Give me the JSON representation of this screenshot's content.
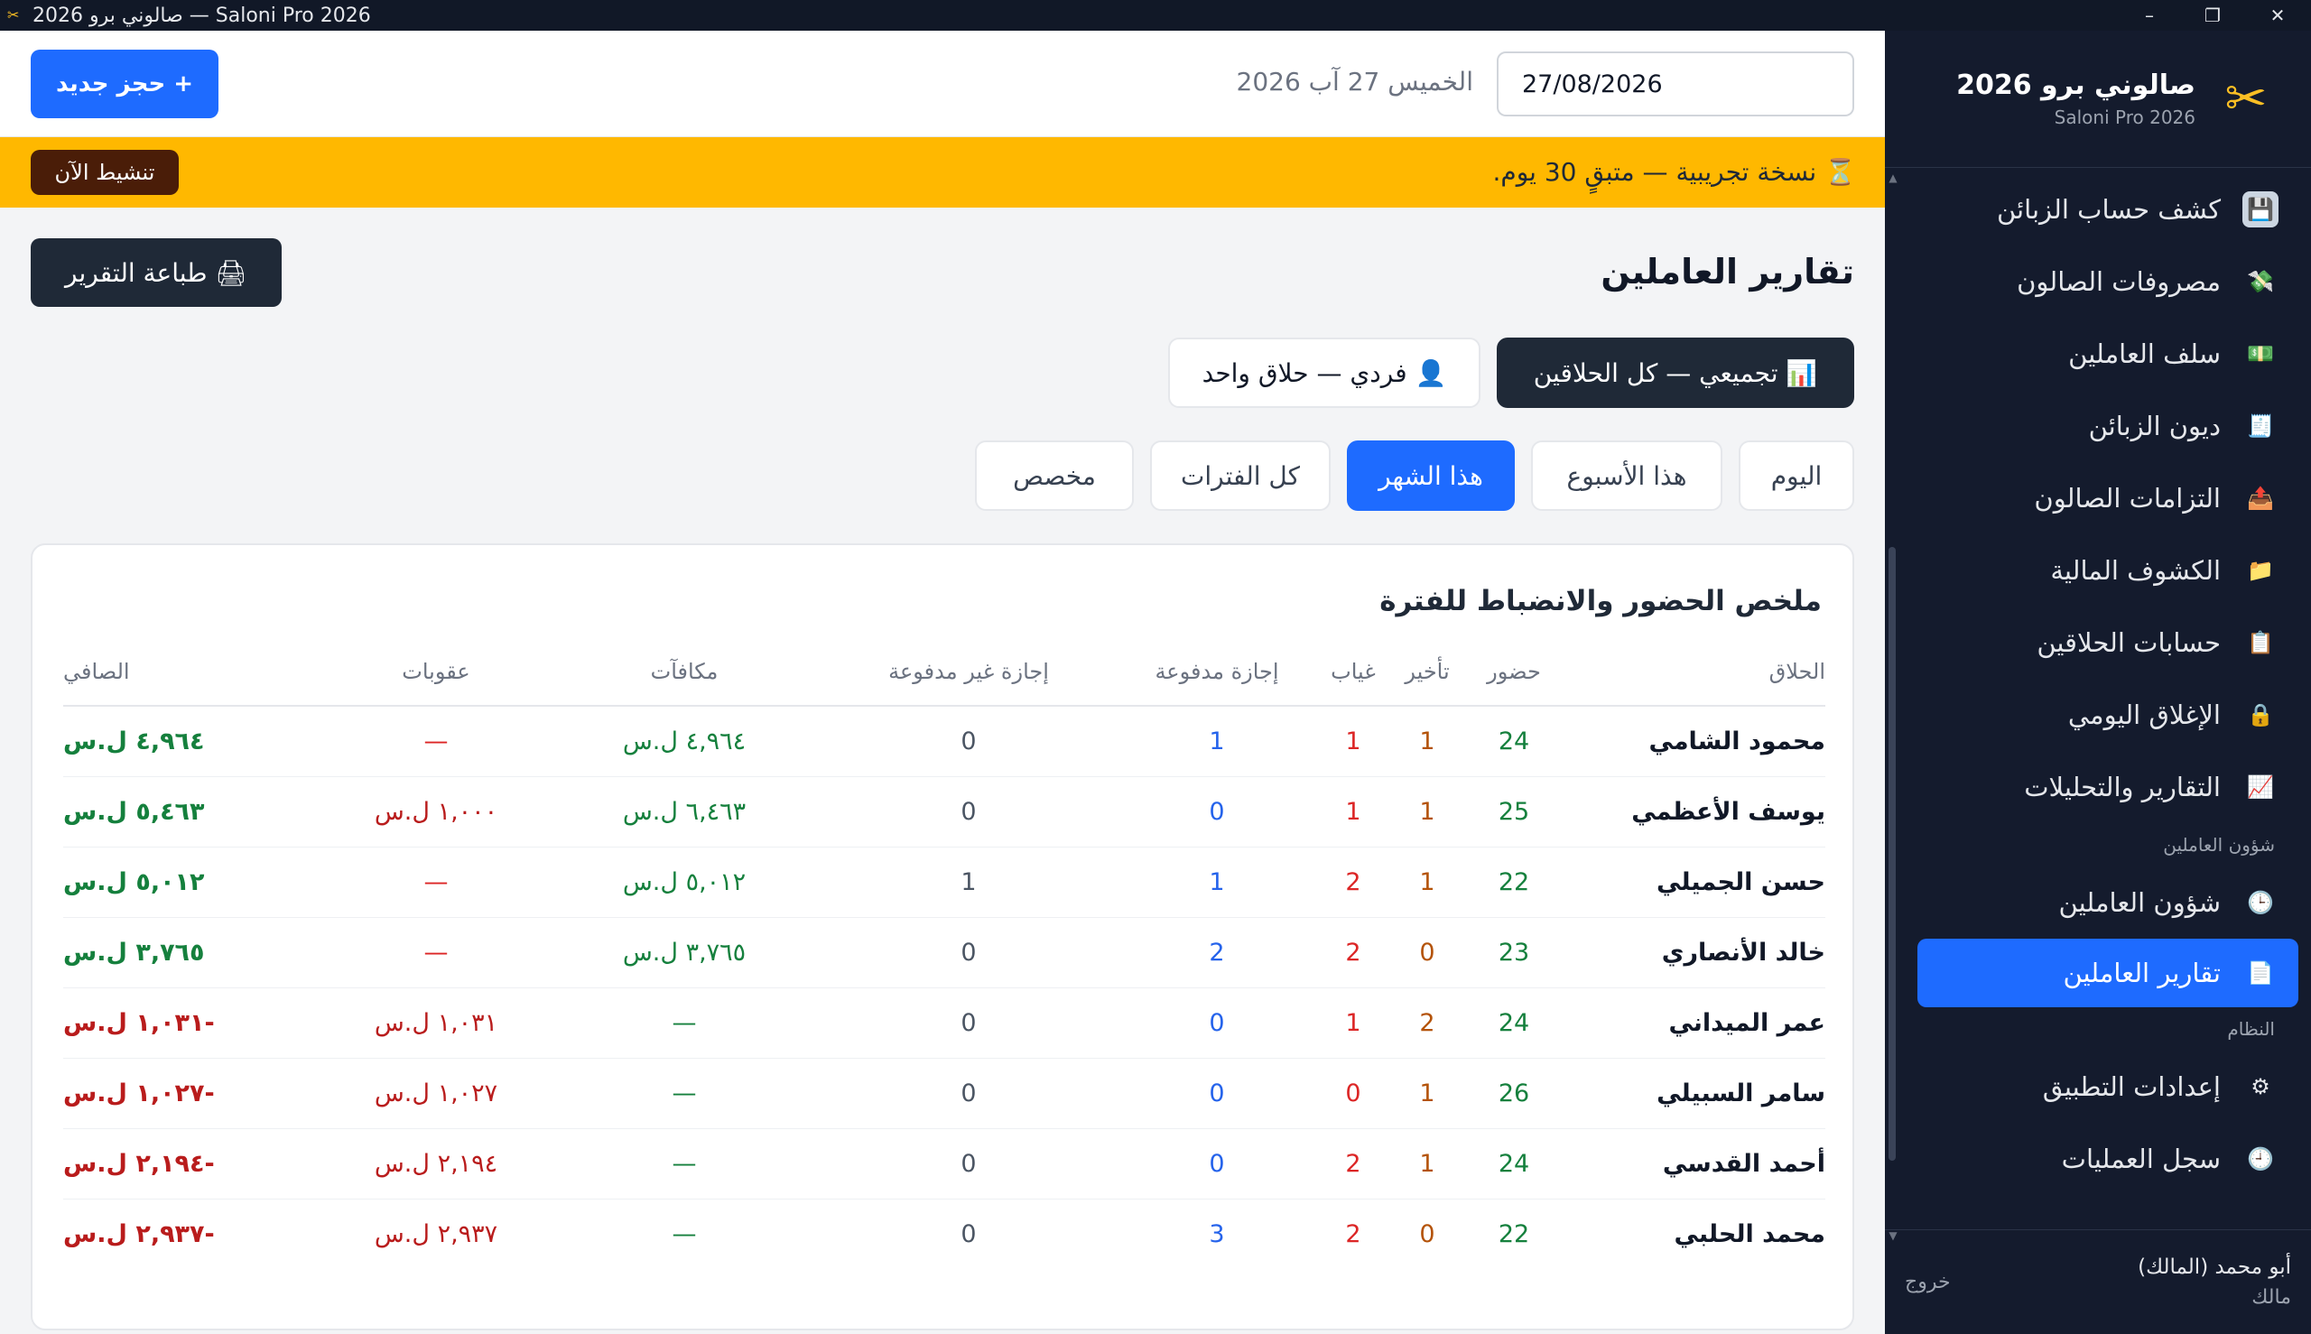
{
  "window": {
    "title": "صالوني برو 2026 — Saloni Pro 2026",
    "minimize": "–",
    "maximize": "❐",
    "close": "✕"
  },
  "brand": {
    "name": "صالوني برو 2026",
    "subtitle": "Saloni Pro 2026"
  },
  "sidebar": {
    "items": [
      {
        "label": "كشف حساب الزبائن",
        "icon": "💾"
      },
      {
        "label": "مصروفات الصالون",
        "icon": "💸"
      },
      {
        "label": "سلف العاملين",
        "icon": "💵"
      },
      {
        "label": "ديون الزبائن",
        "icon": "🧾"
      },
      {
        "label": "التزامات الصالون",
        "icon": "📤"
      },
      {
        "label": "الكشوف المالية",
        "icon": "📁"
      },
      {
        "label": "حسابات الحلاقين",
        "icon": "📋"
      },
      {
        "label": "الإغلاق اليومي",
        "icon": "🔒"
      },
      {
        "label": "التقارير والتحليلات",
        "icon": "📈"
      }
    ],
    "section_staff": "شؤون العاملين",
    "staff_items": [
      {
        "label": "شؤون العاملين",
        "icon": "🕒"
      },
      {
        "label": "تقارير العاملين",
        "icon": "📄"
      }
    ],
    "section_system": "النظام",
    "system_items": [
      {
        "label": "إعدادات التطبيق",
        "icon": "⚙"
      },
      {
        "label": "سجل العمليات",
        "icon": "🕘"
      }
    ],
    "user_name": "أبو محمد (المالك)",
    "user_role": "مالك",
    "logout": "خروج"
  },
  "topbar": {
    "new_booking": "+ حجز جديد",
    "date_label": "الخميس 27 آب 2026",
    "date_value": "27/08/2026"
  },
  "trial": {
    "text": "⏳ نسخة تجريبية — متبقٍ 30 يوم.",
    "activate": "تنشيط الآن"
  },
  "page": {
    "title": "تقارير العاملين",
    "print": "🖨 طباعة التقرير"
  },
  "modes": {
    "aggregate": "📊 تجميعي — كل الحلاقين",
    "individual": "👤 فردي — حلاق واحد"
  },
  "periods": {
    "today": "اليوم",
    "week": "هذا الأسبوع",
    "month": "هذا الشهر",
    "all": "كل الفترات",
    "custom": "مخصص"
  },
  "summary": {
    "title": "ملخص الحضور والانضباط للفترة",
    "headers": {
      "barber": "الحلاق",
      "present": "حضور",
      "late": "تأخير",
      "absent": "غياب",
      "paid_leave": "إجازة مدفوعة",
      "unpaid_leave": "إجازة غير مدفوعة",
      "bonuses": "مكافآت",
      "penalties": "عقوبات",
      "net": "الصافي"
    },
    "rows": [
      {
        "name": "محمود الشامي",
        "present": "24",
        "late": "1",
        "absent": "1",
        "paid": "1",
        "unpaid": "0",
        "bonus": "٤,٩٦٤ ل.س",
        "penalty": "—",
        "net": "٤,٩٦٤ ل.س"
      },
      {
        "name": "يوسف الأعظمي",
        "present": "25",
        "late": "1",
        "absent": "1",
        "paid": "0",
        "unpaid": "0",
        "bonus": "٦,٤٦٣ ل.س",
        "penalty": "١,٠٠٠ ل.س",
        "net": "٥,٤٦٣ ل.س"
      },
      {
        "name": "حسن الجميلي",
        "present": "22",
        "late": "1",
        "absent": "2",
        "paid": "1",
        "unpaid": "1",
        "bonus": "٥,٠١٢ ل.س",
        "penalty": "—",
        "net": "٥,٠١٢ ل.س"
      },
      {
        "name": "خالد الأنصاري",
        "present": "23",
        "late": "0",
        "absent": "2",
        "paid": "2",
        "unpaid": "0",
        "bonus": "٣,٧٦٥ ل.س",
        "penalty": "—",
        "net": "٣,٧٦٥ ل.س"
      },
      {
        "name": "عمر الميداني",
        "present": "24",
        "late": "2",
        "absent": "1",
        "paid": "0",
        "unpaid": "0",
        "bonus": "—",
        "penalty": "١,٠٣١ ل.س",
        "net": "-١,٠٣١ ل.س"
      },
      {
        "name": "سامر السبيلي",
        "present": "26",
        "late": "1",
        "absent": "0",
        "paid": "0",
        "unpaid": "0",
        "bonus": "—",
        "penalty": "١,٠٢٧ ل.س",
        "net": "-١,٠٢٧ ل.س"
      },
      {
        "name": "أحمد القدسي",
        "present": "24",
        "late": "1",
        "absent": "2",
        "paid": "0",
        "unpaid": "0",
        "bonus": "—",
        "penalty": "٢,١٩٤ ل.س",
        "net": "-٢,١٩٤ ل.س"
      },
      {
        "name": "محمد الحلبي",
        "present": "22",
        "late": "0",
        "absent": "2",
        "paid": "3",
        "unpaid": "0",
        "bonus": "—",
        "penalty": "٢,٩٣٧ ل.س",
        "net": "-٢,٩٣٧ ل.س"
      }
    ]
  }
}
